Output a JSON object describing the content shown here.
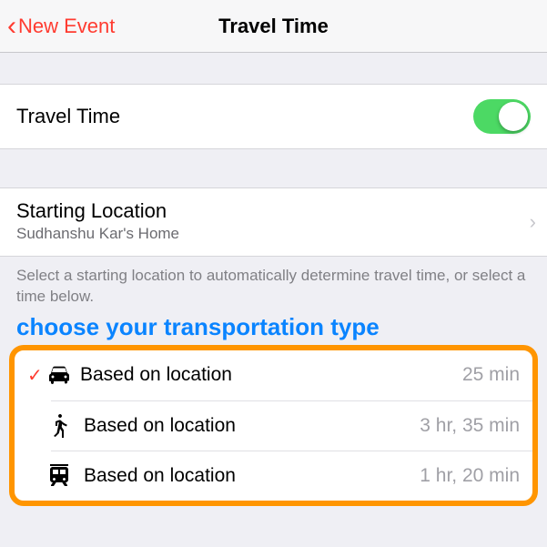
{
  "navbar": {
    "back_label": "New Event",
    "title": "Travel Time"
  },
  "travel_time_row": {
    "label": "Travel Time",
    "enabled": true
  },
  "starting_location": {
    "title": "Starting Location",
    "subtitle": "Sudhanshu Kar's Home"
  },
  "hint_text": "Select a starting location to automatically determine travel time, or select a time below.",
  "overlay_text": "choose your transportation type",
  "options": [
    {
      "icon": "car",
      "label": "Based on location",
      "time": "25 min",
      "selected": true
    },
    {
      "icon": "walk",
      "label": "Based on location",
      "time": "3 hr, 35 min",
      "selected": false
    },
    {
      "icon": "train",
      "label": "Based on location",
      "time": "1 hr, 20 min",
      "selected": false
    }
  ]
}
